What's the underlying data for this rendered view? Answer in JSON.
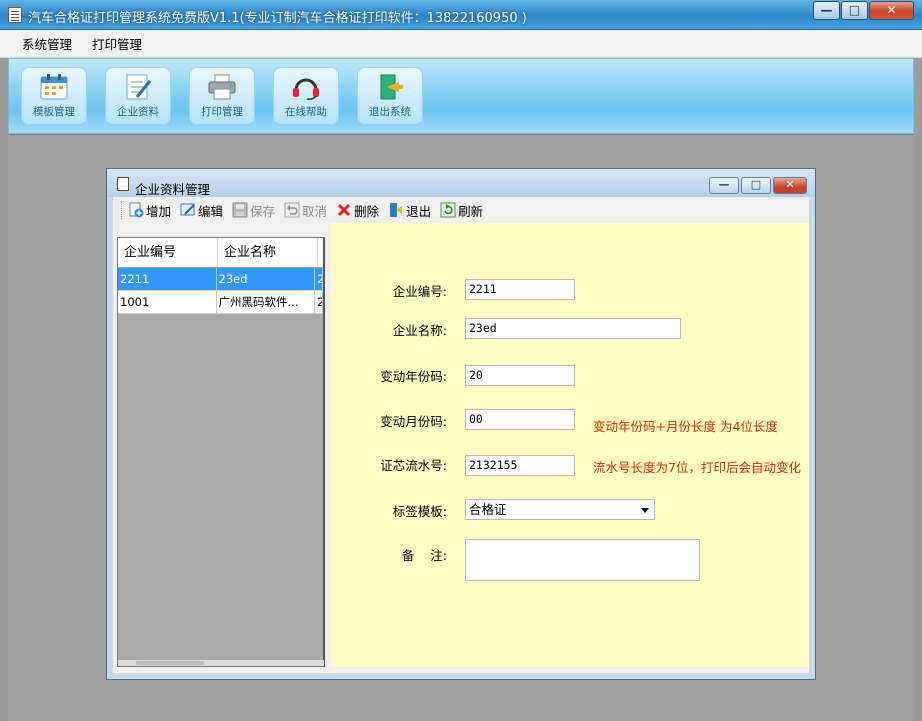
{
  "window": {
    "title": "汽车合格证打印管理系统免费版V1.1(专业订制汽车合格证打印软件：13822160950 )",
    "minimize_glyph": "—",
    "maximize_glyph": "□",
    "close_glyph": "✕"
  },
  "menu": {
    "items": [
      "系统管理",
      "打印管理"
    ]
  },
  "toolbar": {
    "buttons": [
      {
        "label": "模板管理",
        "icon": "calendar-icon"
      },
      {
        "label": "企业资料",
        "icon": "document-edit-icon"
      },
      {
        "label": "打印管理",
        "icon": "printer-icon"
      },
      {
        "label": "在线帮助",
        "icon": "headset-icon"
      },
      {
        "label": "退出系统",
        "icon": "exit-door-icon"
      }
    ]
  },
  "child_window": {
    "title": "企业资料管理",
    "minimize_glyph": "—",
    "maximize_glyph": "□",
    "close_glyph": "✕",
    "tools": [
      {
        "label": "增加",
        "icon": "add-icon",
        "enabled": true
      },
      {
        "label": "编辑",
        "icon": "edit-icon",
        "enabled": true
      },
      {
        "label": "保存",
        "icon": "save-icon",
        "enabled": false
      },
      {
        "label": "取消",
        "icon": "undo-icon",
        "enabled": false
      },
      {
        "label": "删除",
        "icon": "delete-icon",
        "enabled": true
      },
      {
        "label": "退出",
        "icon": "exit-icon",
        "enabled": true
      },
      {
        "label": "刷新",
        "icon": "refresh-icon",
        "enabled": true
      }
    ],
    "grid": {
      "columns": [
        "企业编号",
        "企业名称"
      ],
      "rows": [
        {
          "id": "2211",
          "name": "23ed",
          "extra": "2",
          "selected": true
        },
        {
          "id": "1001",
          "name": "广州黑码软件...",
          "extra": "2",
          "selected": false
        }
      ]
    },
    "form": {
      "company_id": {
        "label": "企业编号:",
        "value": "2211"
      },
      "company_name": {
        "label": "企业名称:",
        "value": "23ed"
      },
      "year_code": {
        "label": "变动年份码:",
        "value": "20"
      },
      "month_code": {
        "label": "变动月份码:",
        "value": "00"
      },
      "serial_no": {
        "label": "证芯流水号:",
        "value": "2132155"
      },
      "template": {
        "label": "标签模板:",
        "value": "合格证"
      },
      "remark": {
        "label": "备    注:",
        "value": ""
      },
      "hint_year_month": "变动年份码+月份长度  为4位长度",
      "hint_serial": "流水号长度为7位，打印后会自动变化"
    }
  },
  "colors": {
    "form_bg": "#ffffc4",
    "hint": "#d52b00",
    "selected_row": "#3399ff"
  }
}
